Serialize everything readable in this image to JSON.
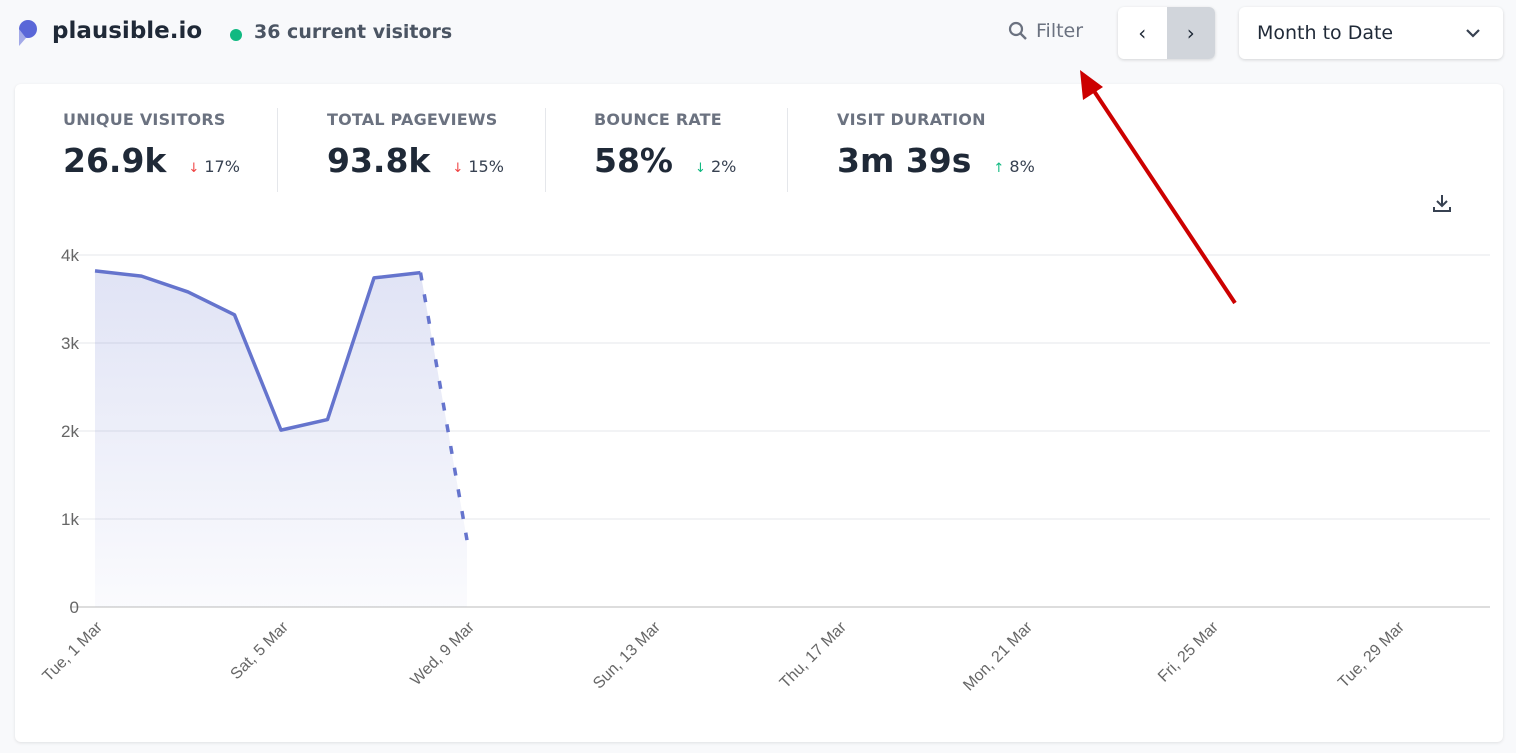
{
  "header": {
    "site": "plausible.io",
    "current_visitors": "36 current visitors",
    "filter_label": "Filter",
    "prev": "‹",
    "next": "›",
    "period": "Month to Date"
  },
  "stats": [
    {
      "label": "UNIQUE VISITORS",
      "value": "26.9k",
      "change": "17%",
      "direction": "down",
      "color": "#ef4444"
    },
    {
      "label": "TOTAL PAGEVIEWS",
      "value": "93.8k",
      "change": "15%",
      "direction": "down",
      "color": "#ef4444"
    },
    {
      "label": "BOUNCE RATE",
      "value": "58%",
      "change": "2%",
      "direction": "down",
      "color": "#10b981"
    },
    {
      "label": "VISIT DURATION",
      "value": "3m 39s",
      "change": "8%",
      "direction": "up",
      "color": "#10b981"
    }
  ],
  "colors": {
    "accent": "#6574cd",
    "live": "#10b981",
    "annotation": "#cc0000"
  },
  "chart_data": {
    "type": "area",
    "x": [
      "1 Mar",
      "2 Mar",
      "3 Mar",
      "4 Mar",
      "5 Mar",
      "6 Mar",
      "7 Mar",
      "8 Mar",
      "9 Mar"
    ],
    "values": [
      3820,
      3760,
      3580,
      3320,
      2010,
      2130,
      3740,
      3800,
      760
    ],
    "dashed_last_segment": true,
    "ylim": [
      0,
      4000
    ],
    "yticks": [
      "0",
      "1k",
      "2k",
      "3k",
      "4k"
    ],
    "xtick_labels": [
      "Tue, 1 Mar",
      "Sat, 5 Mar",
      "Wed, 9 Mar",
      "Sun, 13 Mar",
      "Thu, 17 Mar",
      "Mon, 21 Mar",
      "Fri, 25 Mar",
      "Tue, 29 Mar"
    ],
    "xdays_total": 31,
    "grid": true
  }
}
